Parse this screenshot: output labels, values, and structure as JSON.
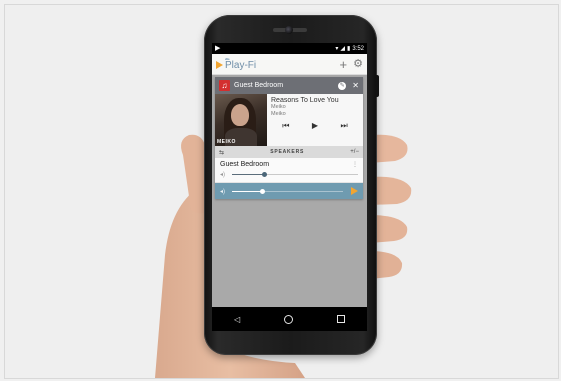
{
  "status_bar": {
    "left_glyph": "▶",
    "time": "3:52"
  },
  "app_bar": {
    "brand_small": "dts",
    "brand_name": "Play-Fi",
    "icons": [
      "plus-icon",
      "gear-icon"
    ]
  },
  "room": {
    "name": "Guest Bedroom"
  },
  "now_playing": {
    "title": "Reasons To Love You",
    "artist": "Meiko",
    "album": "Meiko",
    "album_art_label": "MEIKO"
  },
  "speakers": {
    "label": "SPEAKERS",
    "rows": [
      {
        "name": "Guest Bedroom",
        "volume": 0.25
      }
    ],
    "master_volume": 0.27
  },
  "colors": {
    "accent": "#f2a531",
    "header": "#6d6f75",
    "master_bar": "#6f9bb0",
    "music_icon": "#d32f2f"
  }
}
